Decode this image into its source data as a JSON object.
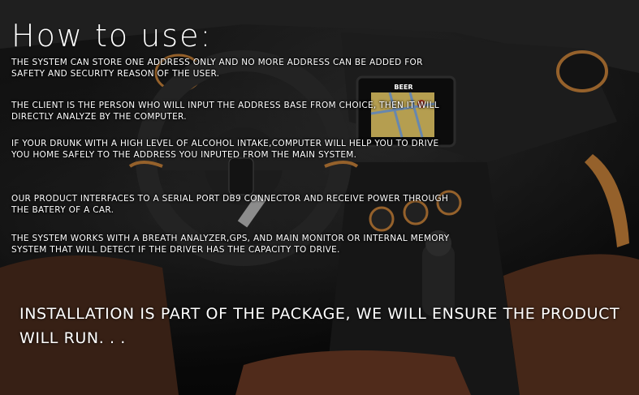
{
  "slide": {
    "title": "How to use:",
    "paragraphs": [
      "The system can store one address only and no more address can be added for safety and security reason of the user.",
      "The client is the person who will input the address base from choice, then it will directly analyze by the computer.",
      "If your drunk with a high level of alcohol intake,computer will help you to drive you home safely to the address you inputed from the main system.",
      "Our product interfaces to a serial port DB9 connector and receive power through the batery of a car.",
      "The system works with a breath analyzer,GPS, and main monitor or internal memory system that will detect if the driver has the capacity to drive."
    ],
    "footer": "Installation is part of the package, we will ensure the product will run. . ."
  },
  "background": {
    "screen_label": "BEER",
    "accent_color": "#c7823a",
    "leather_color": "#6b3a24",
    "map_color": "#f2d36b"
  }
}
